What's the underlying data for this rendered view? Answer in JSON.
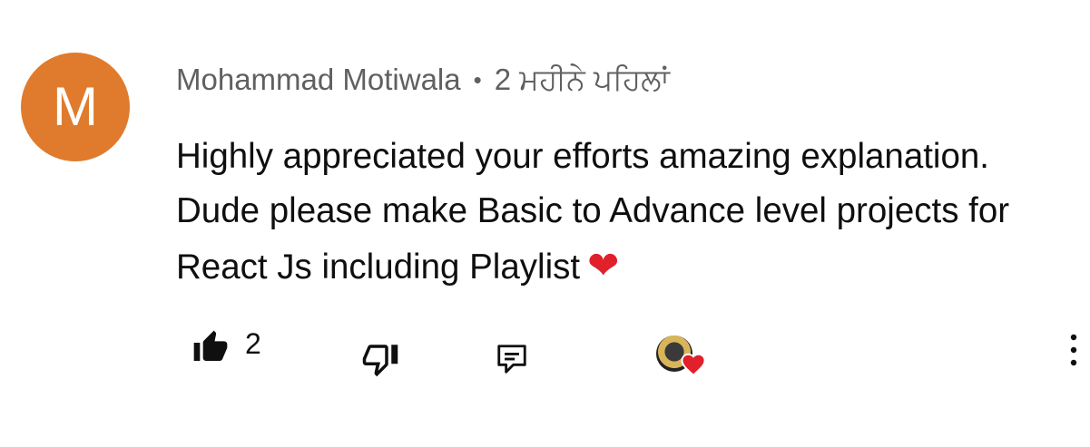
{
  "comment": {
    "avatar_letter": "M",
    "avatar_color": "#e07b2d",
    "author": "Mohammad Motiwala",
    "separator": "•",
    "time": "2 ਮਹੀਨੇ ਪਹਿਲਾਂ",
    "text": "Highly appreciated your efforts amazing explanation. Dude please make Basic to Advance level projects for React Js including Playlist",
    "emoji": "❤"
  },
  "actions": {
    "like_icon": "thumbs-up-icon",
    "like_count": "2",
    "dislike_icon": "thumbs-down-icon",
    "reply_icon": "reply-comment-icon",
    "creator_heart_icon": "creator-heart-icon",
    "more_icon": "more-vertical-icon"
  }
}
